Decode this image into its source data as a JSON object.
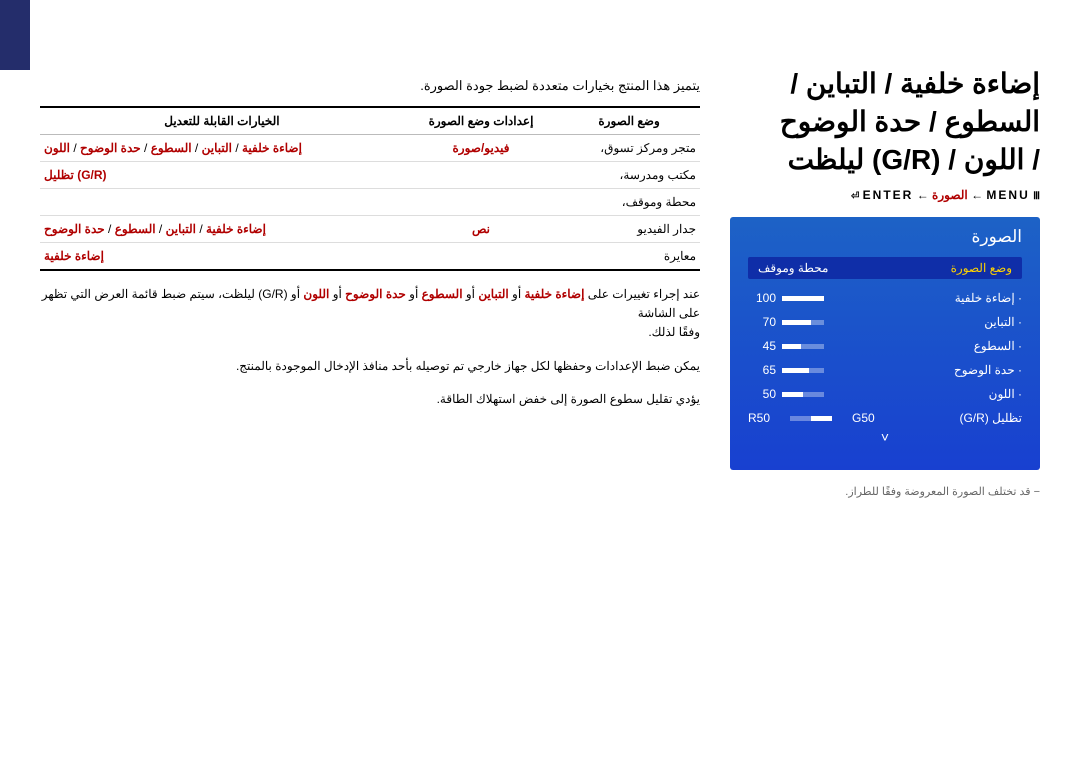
{
  "title_line1": "إضاءة خلفية / التباين / السطوع / حدة الوضوح",
  "title_line2": "/ اللون / (G/R) ليلظت",
  "breadcrumb": {
    "menu_key": "MENU",
    "menu_glyph": "Ⅲ",
    "arrow": "←",
    "picture": "الصورة",
    "enter_key": "ENTER",
    "enter_glyph": "⏎"
  },
  "osd": {
    "title": "الصورة",
    "tab_active": "وضع الصورة",
    "tab_other": "محطة وموقف",
    "items": [
      {
        "label": "إضاءة خلفية",
        "value": "100",
        "fill": 100
      },
      {
        "label": "التباين",
        "value": "70",
        "fill": 70
      },
      {
        "label": "السطوع",
        "value": "45",
        "fill": 45
      },
      {
        "label": "حدة الوضوح",
        "value": "65",
        "fill": 65
      },
      {
        "label": "اللون",
        "value": "50",
        "fill": 50
      }
    ],
    "tint_label": "تظليل (G/R)",
    "tint_g": "G50",
    "tint_r": "R50",
    "chevron": "˅"
  },
  "note": "− قد تختلف الصورة المعروضة وفقًا للطراز.",
  "intro": "يتميز هذا المنتج بخيارات متعددة لضبط جودة الصورة.",
  "table": {
    "headers": [
      "وضع الصورة",
      "إعدادات وضع الصورة",
      "الخيارات القابلة للتعديل"
    ],
    "rows": [
      {
        "mode_black": "متجر ومركز تسوق",
        "mode_punct": "،",
        "setting": "فيديو/صورة",
        "opts": [
          "إضاءة خلفية",
          "التباين",
          "السطوع",
          "حدة الوضوح",
          "اللون"
        ],
        "joiner": " / "
      },
      {
        "mode_black": "مكتب ومدرسة",
        "mode_punct": "،",
        "setting": "",
        "opts_text": "(G/R) تظليل",
        "opts_class": "red"
      },
      {
        "mode_black": "محطة وموقف",
        "mode_punct": "،",
        "setting": "",
        "opts_text": ""
      },
      {
        "mode_black": "جدار الفيديو",
        "mode_punct": "",
        "setting": "نص",
        "opts": [
          "إضاءة خلفية",
          "التباين",
          "السطوع",
          "حدة الوضوح"
        ],
        "joiner": " / "
      },
      {
        "mode_black": "معايرة",
        "mode_punct": "",
        "setting": "",
        "opts": [
          "إضاءة خلفية"
        ],
        "joiner": ""
      }
    ]
  },
  "para1_pre": "عند إجراء تغييرات على ",
  "para1_terms": [
    "إضاءة خلفية",
    "التباين",
    "السطوع",
    "حدة الوضوح",
    "اللون"
  ],
  "para1_or": " أو ",
  "para1_post1": " أو (G/R) ليلظت، سيتم ضبط قائمة العرض التي تظهر على الشاشة",
  "para1_post2": " وفقًا لذلك.",
  "para2": "يمكن ضبط الإعدادات وحفظها لكل جهاز خارجي تم توصيله بأحد منافذ الإدخال الموجودة بالمنتج.",
  "para3": "يؤدي تقليل سطوع الصورة إلى خفض استهلاك الطاقة."
}
